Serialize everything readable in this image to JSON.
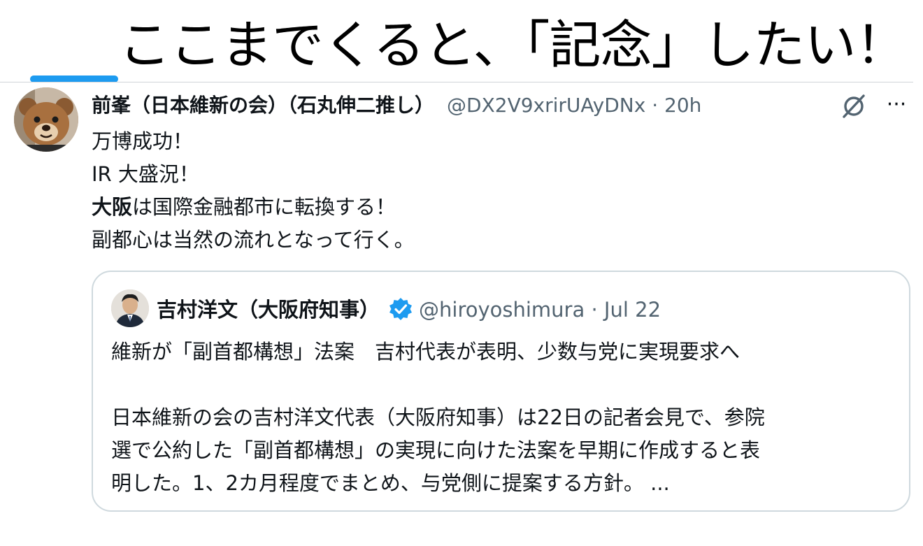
{
  "headline": "ここまでくると、「記念」したい！",
  "colors": {
    "accent": "#1d9bf0",
    "text": "#0f1419",
    "muted": "#536471",
    "border": "#cfd9de"
  },
  "tweet": {
    "author_name": "前峯（日本維新の会）（石丸伸二推し）",
    "handle_time": "@DX2V9xrirUAyDNx · 20h",
    "avatar_icon": "bear-avatar",
    "action_icons": [
      "grok-icon",
      "more-icon"
    ],
    "more_label": "···",
    "lines": [
      {
        "bold": "",
        "text": "万博成功！"
      },
      {
        "bold": "",
        "text": "IR 大盛況！"
      },
      {
        "bold": "大阪",
        "text": "は国際金融都市に転換する！"
      },
      {
        "bold": "",
        "text": "副都心は当然の流れとなって行く。"
      }
    ]
  },
  "quote": {
    "author_name": "吉村洋文（大阪府知事）",
    "verified_icon": "verified-badge-icon",
    "handle_time": "@hiroyoshimura · Jul 22",
    "lines": [
      "維新が「副首都構想」法案　吉村代表が表明、少数与党に実現要求へ",
      "",
      "日本維新の会の吉村洋文代表（大阪府知事）は22日の記者会見で、参院",
      "選で公約した「副首都構想」の実現に向けた法案を早期に作成すると表",
      "明した。1、2カ月程度でまとめ、与党側に提案する方針。 ..."
    ]
  }
}
